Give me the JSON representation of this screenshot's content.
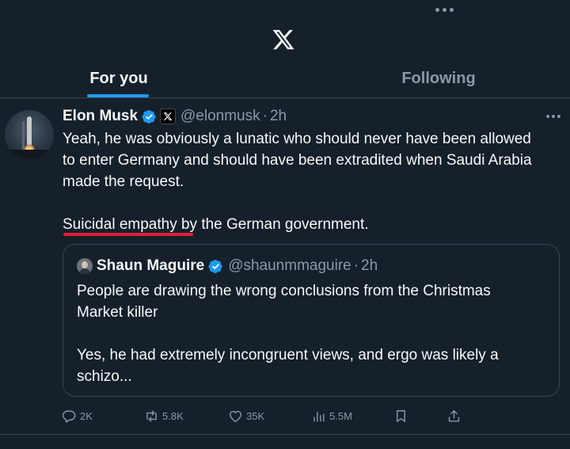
{
  "header": {
    "logo_icon": "x-logo-icon",
    "more_icon": "more-horizontal-icon"
  },
  "tabs": [
    {
      "label": "For you",
      "active": true
    },
    {
      "label": "Following",
      "active": false
    }
  ],
  "post": {
    "author_name": "Elon Musk",
    "handle": "@elonmusk",
    "separator": "·",
    "time": "2h",
    "text_lines": [
      "Yeah, he was obviously a lunatic who should never have been allowed",
      "to enter Germany and should have been extradited when Saudi Arabia",
      "made the request.",
      "Suicidal empathy by the German government."
    ],
    "verified_icon": "verified-badge-icon",
    "affiliation_icon": "x-affiliation-badge-icon"
  },
  "quote": {
    "author_name": "Shaun Maguire",
    "handle": "@shaunmmaguire",
    "separator": "·",
    "time": "2h",
    "text_lines": [
      "People are drawing the wrong conclusions from the Christmas",
      "Market killer",
      "Yes, he had extremely incongruent views, and ergo was likely a",
      "schizo..."
    ]
  },
  "actions": {
    "replies": "2K",
    "reposts": "5.8K",
    "likes": "35K",
    "views": "5.5M"
  },
  "colors": {
    "background": "#15202b",
    "accent": "#1d9bf0",
    "muted": "#8b98a5",
    "highlight_underline": "#e0203a"
  }
}
